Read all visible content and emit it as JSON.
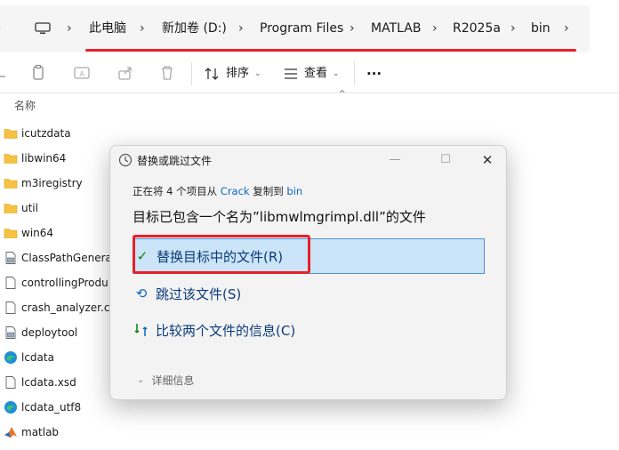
{
  "address_bar": {
    "crumbs": [
      "此电脑",
      "新加卷 (D:)",
      "Program Files",
      "MATLAB",
      "R2025a",
      "bin"
    ]
  },
  "toolbar": {
    "sort_label": "排序",
    "view_label": "查看",
    "more_label": "···"
  },
  "list": {
    "column_name": "名称",
    "files": [
      {
        "name": "icutzdata",
        "icon": "folder-icon"
      },
      {
        "name": "libwin64",
        "icon": "folder-icon"
      },
      {
        "name": "m3iregistry",
        "icon": "folder-icon"
      },
      {
        "name": "util",
        "icon": "folder-icon"
      },
      {
        "name": "win64",
        "icon": "folder-icon"
      },
      {
        "name": "ClassPathGenerat",
        "icon": "app-icon"
      },
      {
        "name": "controllingProdu",
        "icon": "file-icon"
      },
      {
        "name": "crash_analyzer.cf",
        "icon": "file-icon"
      },
      {
        "name": "deploytool",
        "icon": "app-icon"
      },
      {
        "name": "lcdata",
        "icon": "edge-icon"
      },
      {
        "name": "lcdata.xsd",
        "icon": "file-icon"
      },
      {
        "name": "lcdata_utf8",
        "icon": "edge-icon"
      },
      {
        "name": "matlab",
        "icon": "matlab-icon"
      }
    ]
  },
  "dialog": {
    "title": "替换或跳过文件",
    "sub_prefix": "正在将 4 个项目从 ",
    "sub_source": "Crack",
    "sub_middle": " 复制到 ",
    "sub_dest": "bin",
    "heading": "目标已包含一个名为”libmwlmgrimpl.dll”的文件",
    "option_replace": "替换目标中的文件(R)",
    "option_skip": "跳过该文件(S)",
    "option_compare": "比较两个文件的信息(C)",
    "details": "详细信息",
    "colors": {
      "accent": "#0b66c3",
      "highlight": "#cce4f7",
      "annotation_red": "#e8202a"
    }
  }
}
